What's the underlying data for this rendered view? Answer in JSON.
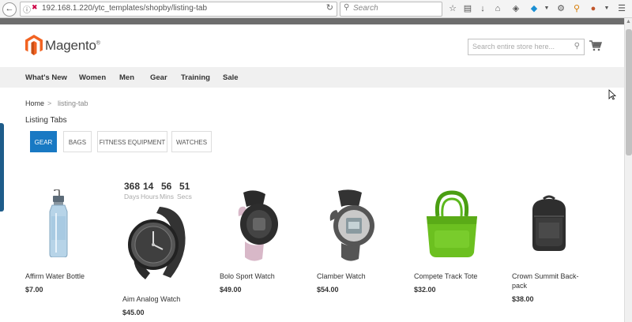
{
  "browser": {
    "url": "192.168.1.220/ytc_templates/shopby/listing-tab",
    "search_placeholder": "Search"
  },
  "header": {
    "logo_text": "Magento",
    "search_placeholder": "Search entire store here..."
  },
  "nav": {
    "items": [
      "What's New",
      "Women",
      "Men",
      "Gear",
      "Training",
      "Sale"
    ]
  },
  "breadcrumb": {
    "home": "Home",
    "separator": ">",
    "current": "listing-tab"
  },
  "section_title": "Listing Tabs",
  "tabs": [
    "GEAR",
    "BAGS",
    "FITNESS EQUIPMENT",
    "WATCHES"
  ],
  "countdown": {
    "days": "368",
    "hours": "14",
    "mins": "56",
    "secs": "51",
    "days_label": "Days",
    "hours_label": "Hours",
    "mins_label": "Mins",
    "secs_label": "Secs"
  },
  "products": [
    {
      "name": "Affirm Water Bottle",
      "price": "$7.00"
    },
    {
      "name": "Aim Analog Watch",
      "price": "$45.00"
    },
    {
      "name": "Bolo Sport Watch",
      "price": "$49.00"
    },
    {
      "name": "Clamber Watch",
      "price": "$54.00"
    },
    {
      "name": "Compete Track Tote",
      "price": "$32.00"
    },
    {
      "name": "Crown Summit Back-pack",
      "name_line1": "Crown Summit Back-",
      "name_line2": "pack",
      "price": "$38.00"
    }
  ],
  "colors": {
    "accent": "#1979c3",
    "logo": "#f26322"
  }
}
